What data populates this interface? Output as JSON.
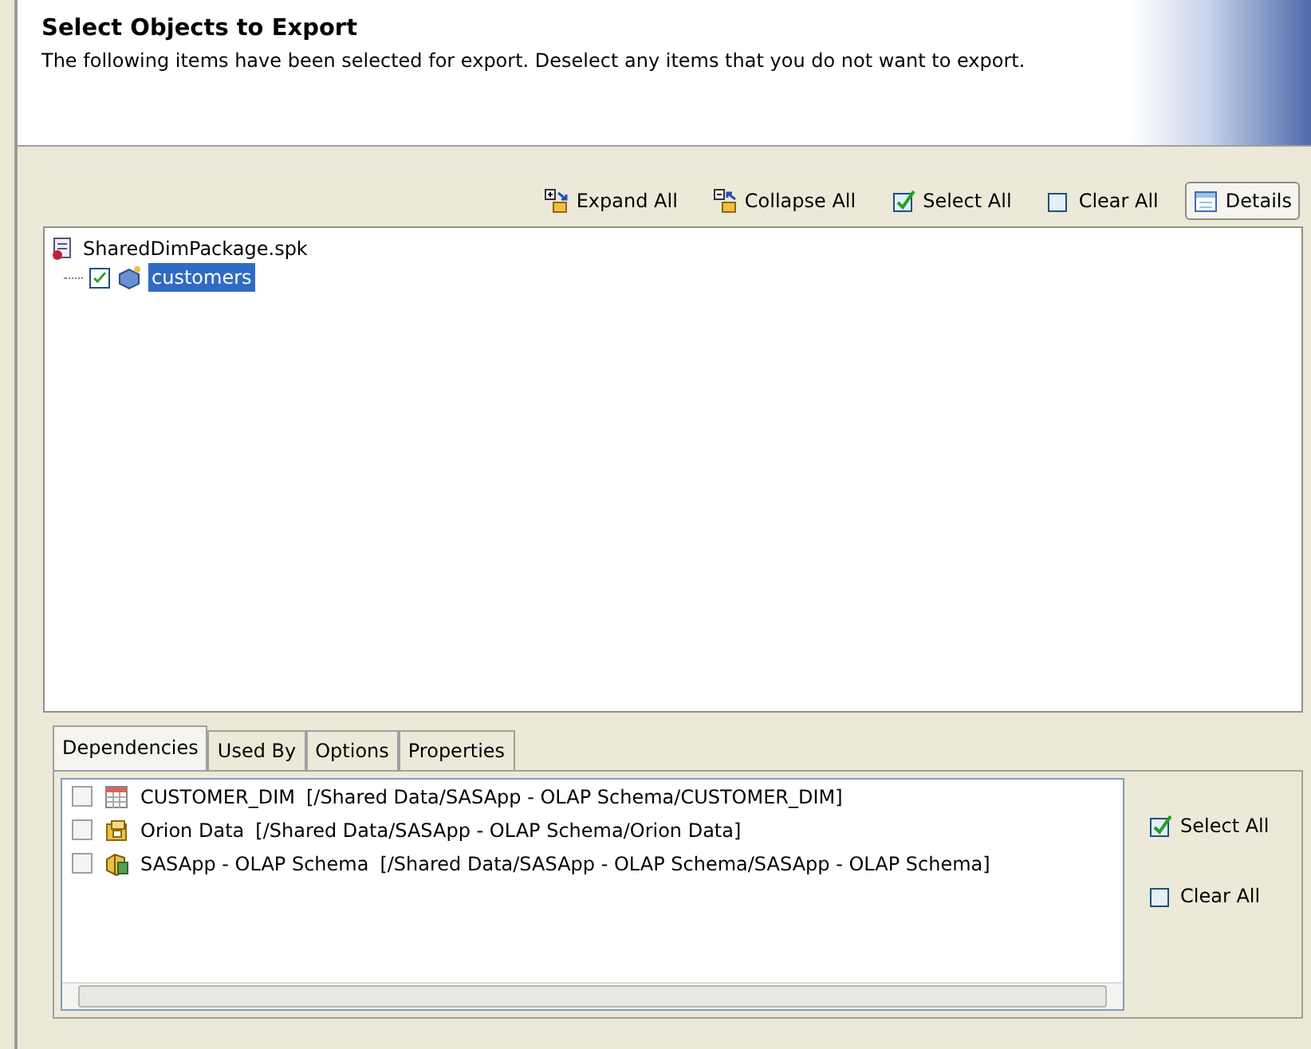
{
  "header": {
    "title": "Select Objects to Export",
    "description": "The following items have been selected for export.  Deselect any items that you do not want to export."
  },
  "toolbar": [
    {
      "kind": "expand",
      "label": "Expand All"
    },
    {
      "kind": "collapse",
      "label": "Collapse All"
    },
    {
      "kind": "select",
      "label": "Select All"
    },
    {
      "kind": "clear",
      "label": "Clear All"
    },
    {
      "kind": "details",
      "label": "Details",
      "selected": true
    }
  ],
  "tree": {
    "label": "SharedDimPackage.spk",
    "children": [
      {
        "label": "customers",
        "checked": true,
        "selected": true
      }
    ]
  },
  "tabs": [
    {
      "label": "Dependencies",
      "selected": true
    },
    {
      "label": "Used By",
      "selected": false
    },
    {
      "label": "Options",
      "selected": false
    },
    {
      "label": "Properties",
      "selected": false
    }
  ],
  "dependencies": [
    {
      "kind": "table",
      "name": "CUSTOMER_DIM",
      "path": "[/Shared Data/SASApp - OLAP Schema/CUSTOMER_DIM]",
      "checked": false
    },
    {
      "kind": "library",
      "name": "Orion Data",
      "path": "[/Shared Data/SASApp - OLAP Schema/Orion Data]",
      "checked": false
    },
    {
      "kind": "schema",
      "name": "SASApp - OLAP Schema",
      "path": "[/Shared Data/SASApp - OLAP Schema/SASApp - OLAP Schema]",
      "checked": false
    }
  ],
  "side_buttons": [
    {
      "kind": "select",
      "label": "Select All"
    },
    {
      "kind": "clear",
      "label": "Clear All"
    }
  ]
}
